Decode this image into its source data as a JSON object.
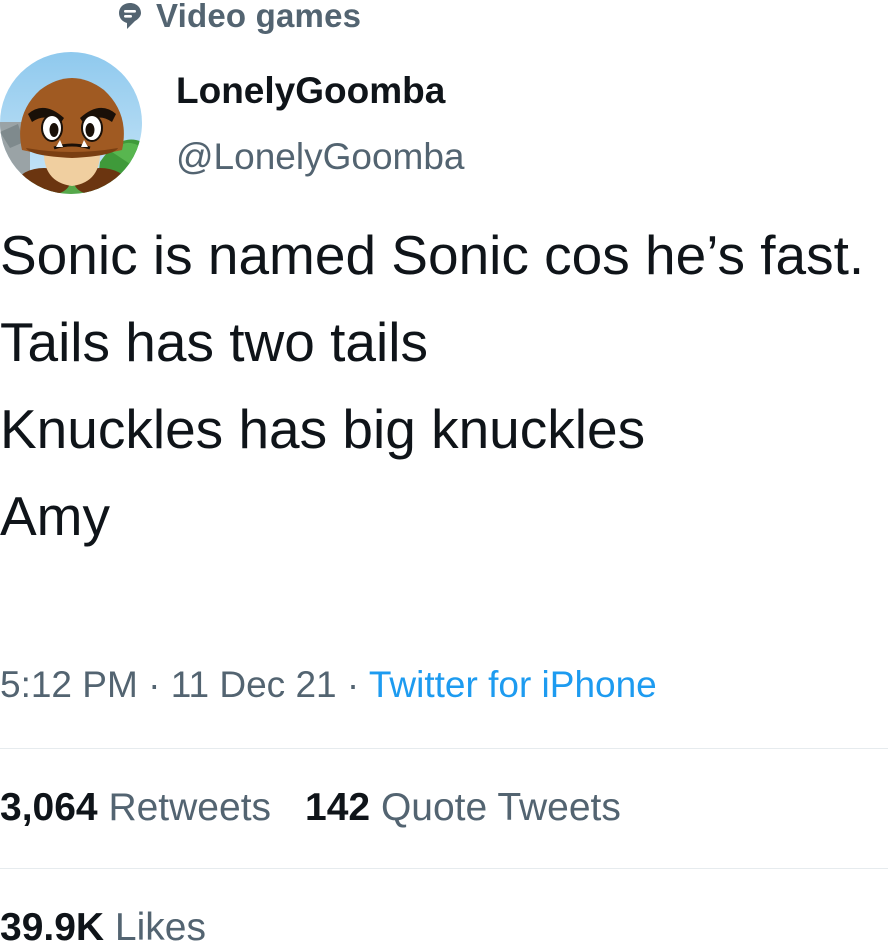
{
  "topic": {
    "icon": "topic-bubble-icon",
    "label": "Video games"
  },
  "author": {
    "avatar": "goomba-avatar",
    "display_name": "LonelyGoomba",
    "handle": "@LonelyGoomba"
  },
  "tweet": {
    "lines": [
      "Sonic is named Sonic cos he’s fast.",
      "Tails has two tails",
      "Knuckles has big knuckles",
      "Amy"
    ],
    "time": "5:12 PM",
    "date": "11 Dec 21",
    "separator": "·",
    "source": "Twitter for iPhone"
  },
  "stats": {
    "retweets_count": "3,064",
    "retweets_label": "Retweets",
    "quotes_count": "142",
    "quotes_label": "Quote Tweets",
    "likes_count": "39.9K",
    "likes_label": "Likes"
  },
  "colors": {
    "text_primary": "#0f1419",
    "text_secondary": "#536471",
    "link": "#1d9bf0",
    "divider": "#e6ebee"
  }
}
